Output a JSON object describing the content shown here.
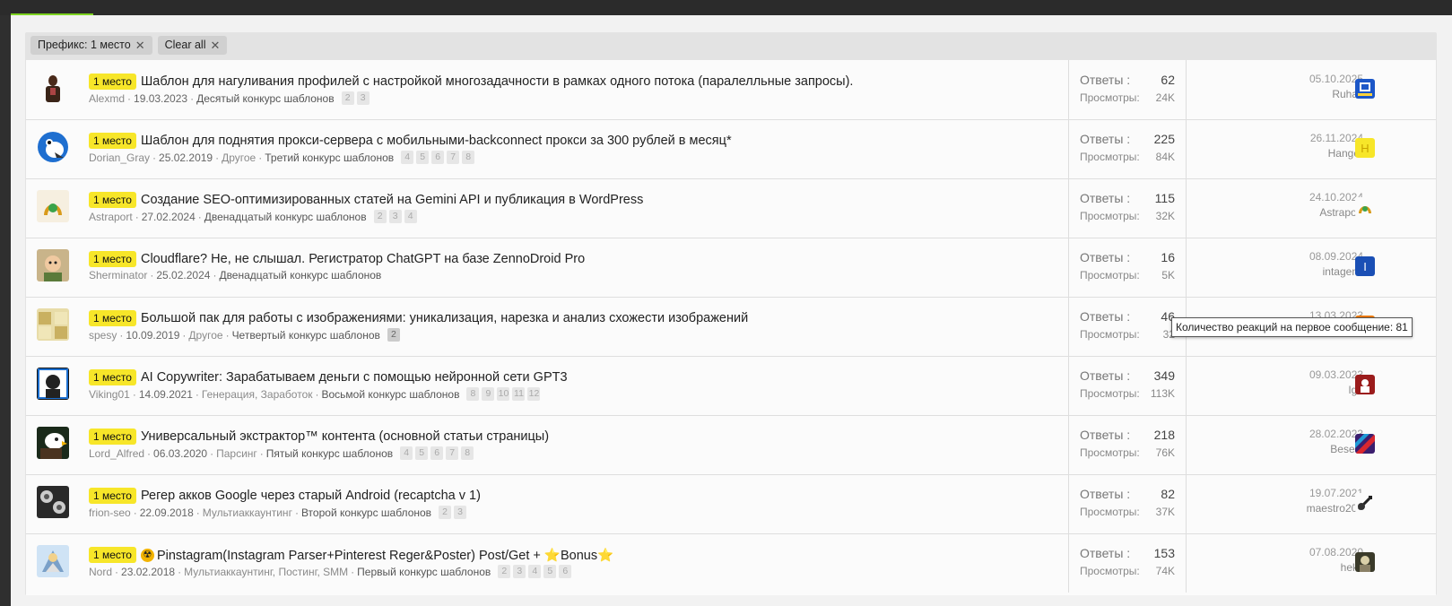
{
  "filters": {
    "prefix_chip": "Префикс: 1 место",
    "clear_all": "Clear all",
    "close_glyph": "✕"
  },
  "stat_labels": {
    "replies": "Ответы :",
    "views": "Просмотры:"
  },
  "tooltip": "Количество реакций на первое сообщение: 81",
  "threads": [
    {
      "prefix": "1 место",
      "title": "Шаблон для нагуливания профилей с настройкой многозадачности в рамках одного потока (паралелльные запросы).",
      "author": "Alexmd",
      "date": "19.03.2023",
      "category": "",
      "contest": "Десятый конкурс шаблонов",
      "pages": [
        "2",
        "3"
      ],
      "replies": "62",
      "views": "24K",
      "last_date": "05.10.2025",
      "last_user": "Ruhas"
    },
    {
      "prefix": "1 место",
      "title": "Шаблон для поднятия прокси-сервера с мобильными-backconnect прокси за 300 рублей в месяц*",
      "author": "Dorian_Gray",
      "date": "25.02.2019",
      "category": "Другое",
      "contest": "Третий конкурс шаблонов",
      "pages": [
        "4",
        "5",
        "6",
        "7",
        "8"
      ],
      "replies": "225",
      "views": "84K",
      "last_date": "26.11.2024",
      "last_user": "Hanger",
      "last_initial": "H"
    },
    {
      "prefix": "1 место",
      "title": "Создание SEO-оптимизированных статей на Gemini API и публикация в WordPress",
      "author": "Astraport",
      "date": "27.02.2024",
      "category": "",
      "contest": "Двенадцатый конкурс шаблонов",
      "pages": [
        "2",
        "3",
        "4"
      ],
      "replies": "115",
      "views": "32K",
      "last_date": "24.10.2024",
      "last_user": "Astraport"
    },
    {
      "prefix": "1 место",
      "title": "Cloudflare? Не, не слышал. Регистратор ChatGPT на базе ZennoDroid Pro",
      "author": "Sherminator",
      "date": "25.02.2024",
      "category": "",
      "contest": "Двенадцатый конкурс шаблонов",
      "pages": [],
      "replies": "16",
      "views": "5K",
      "last_date": "08.09.2024",
      "last_user": "intagens",
      "last_initial": "I"
    },
    {
      "prefix": "1 место",
      "title": "Большой пак для работы с изображениями: уникализация, нарезка и анализ схожести изображений",
      "author": "spesy",
      "date": "10.09.2019",
      "category": "Другое",
      "contest": "Четвертый конкурс шаблонов",
      "pages": [
        "2"
      ],
      "replies": "46",
      "views": "32",
      "last_date": "13.03.2023",
      "last_user": "",
      "last_initial": "L"
    },
    {
      "prefix": "1 место",
      "title": "AI Copywriter: Зарабатываем деньги с помощью нейронной сети GPT3",
      "author": "Viking01",
      "date": "14.09.2021",
      "category": "Генерация, Заработок",
      "contest": "Восьмой конкурс шаблонов",
      "pages": [
        "8",
        "9",
        "10",
        "11",
        "12"
      ],
      "replies": "349",
      "views": "113K",
      "last_date": "09.03.2023",
      "last_user": "Iga"
    },
    {
      "prefix": "1 место",
      "title": "Универсальный экстрактор™ контента (основной статьи страницы)",
      "author": "Lord_Alfred",
      "date": "06.03.2020",
      "category": "Парсинг",
      "contest": "Пятый конкурс шаблонов",
      "pages": [
        "4",
        "5",
        "6",
        "7",
        "8"
      ],
      "replies": "218",
      "views": "76K",
      "last_date": "28.02.2023",
      "last_user": "Besedi"
    },
    {
      "prefix": "1 место",
      "title": "Регер акков Google через старый Android (recaptcha v 1)",
      "author": "frion-seo",
      "date": "22.09.2018",
      "category": "Мультиаккаунтинг",
      "contest": "Второй конкурс шаблонов",
      "pages": [
        "2",
        "3"
      ],
      "replies": "82",
      "views": "37K",
      "last_date": "19.07.2021",
      "last_user": "maestro202"
    },
    {
      "prefix": "1 место",
      "title": "Pinstagram(Instagram Parser+Pinterest Reger&Poster) Post/Get + ⭐Bonus⭐",
      "title_emoji": "☢",
      "author": "Nord",
      "date": "23.02.2018",
      "category": "Мультиаккаунтинг, Постинг, SMM",
      "contest": "Первый конкурс шаблонов",
      "pages": [
        "2",
        "3",
        "4",
        "5",
        "6"
      ],
      "replies": "153",
      "views": "74K",
      "last_date": "07.08.2020",
      "last_user": "heks"
    }
  ],
  "colors": {
    "prefix_bg": "#f7e629",
    "progress": "#7ed321",
    "hanger_avatar": "#f7e629",
    "intagens_avatar": "#1a4fb5",
    "spesy_last_avatar": "#f07b00"
  }
}
